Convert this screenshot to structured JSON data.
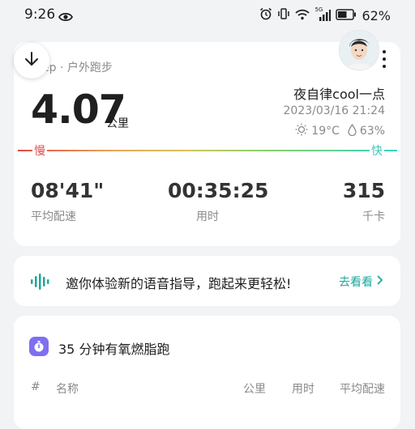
{
  "status_bar": {
    "time": "9:26",
    "network_badge": "5G",
    "battery_percent": "62%",
    "battery_level": 0.62
  },
  "header": {
    "back_icon": "arrow-down-icon",
    "more_icon": "more-vertical-icon"
  },
  "run": {
    "source": "ep · 户外跑步",
    "distance": "4.07",
    "distance_unit": "公里",
    "username": "夜自律cool一点",
    "datetime": "2023/03/16 21:24",
    "temperature": "19°C",
    "humidity": "63%",
    "pace_slow_label": "慢",
    "pace_fast_label": "快"
  },
  "stats": [
    {
      "value": "08'41\"",
      "label": "平均配速"
    },
    {
      "value": "00:35:25",
      "label": "用时"
    },
    {
      "value": "315",
      "label": "千卡"
    }
  ],
  "voice": {
    "text": "邀你体验新的语音指导，跑起来更轻松!",
    "link": "去看看"
  },
  "workout": {
    "title": "35 分钟有氧燃脂跑",
    "columns": [
      "#",
      "名称",
      "公里",
      "用时",
      "平均配速"
    ]
  },
  "colors": {
    "slow": "#e04b47",
    "fast": "#3ac7bd",
    "accent": "#1ba899",
    "badge": "#7e70ef"
  }
}
